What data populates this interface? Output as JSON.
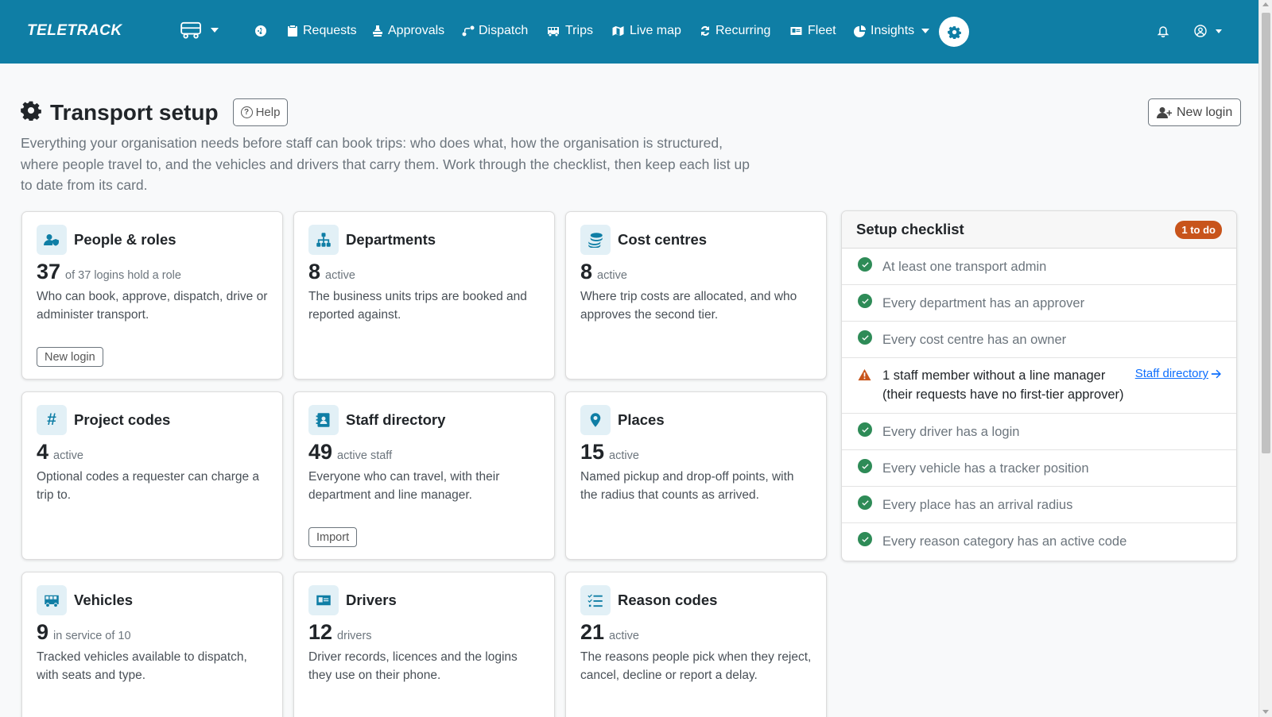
{
  "nav": {
    "brand": "TELETRACK",
    "items": [
      {
        "label": "Requests",
        "icon": "clipboard-icon"
      },
      {
        "label": "Approvals",
        "icon": "stamp-icon"
      },
      {
        "label": "Dispatch",
        "icon": "route-icon"
      },
      {
        "label": "Trips",
        "icon": "bus-icon"
      },
      {
        "label": "Live map",
        "icon": "map-icon"
      },
      {
        "label": "Recurring",
        "icon": "repeat-icon"
      },
      {
        "label": "Fleet",
        "icon": "id-card-icon"
      },
      {
        "label": "Insights",
        "icon": "pie-chart-icon"
      }
    ]
  },
  "header": {
    "title": "Transport setup",
    "help_label": "Help",
    "new_login_label": "New login",
    "intro": "Everything your organisation needs before staff can book trips: who does what, how the organisation is structured, where people travel to, and the vehicles and drivers that carry them. Work through the checklist, then keep each list up to date from its card."
  },
  "cards": [
    {
      "title": "People & roles",
      "icon": "user-shield-icon",
      "count": "37",
      "count_sub": "of 37 logins hold a role",
      "desc": "Who can book, approve, dispatch, drive or administer transport.",
      "button": "New login"
    },
    {
      "title": "Departments",
      "icon": "sitemap-icon",
      "count": "8",
      "count_sub": "active",
      "desc": "The business units trips are booked and reported against.",
      "button": ""
    },
    {
      "title": "Cost centres",
      "icon": "coins-icon",
      "count": "8",
      "count_sub": "active",
      "desc": "Where trip costs are allocated, and who approves the second tier.",
      "button": ""
    },
    {
      "title": "Project codes",
      "icon": "hash-icon",
      "count": "4",
      "count_sub": "active",
      "desc": "Optional codes a requester can charge a trip to.",
      "button": ""
    },
    {
      "title": "Staff directory",
      "icon": "address-book-icon",
      "count": "49",
      "count_sub": "active staff",
      "desc": "Everyone who can travel, with their department and line manager.",
      "button": "Import"
    },
    {
      "title": "Places",
      "icon": "map-pin-icon",
      "count": "15",
      "count_sub": "active",
      "desc": "Named pickup and drop-off points, with the radius that counts as arrived.",
      "button": ""
    },
    {
      "title": "Vehicles",
      "icon": "bus-icon",
      "count": "9",
      "count_sub": "in service of 10",
      "desc": "Tracked vehicles available to dispatch, with seats and type.",
      "button": ""
    },
    {
      "title": "Drivers",
      "icon": "id-card-icon",
      "count": "12",
      "count_sub": "drivers",
      "desc": "Driver records, licences and the logins they use on their phone.",
      "button": ""
    },
    {
      "title": "Reason codes",
      "icon": "list-check-icon",
      "count": "21",
      "count_sub": "active",
      "desc": "The reasons people pick when they reject, cancel, decline or report a delay.",
      "button": ""
    }
  ],
  "checklist": {
    "title": "Setup checklist",
    "badge": "1 to do",
    "items": [
      {
        "text": "At least one transport admin",
        "status": "ok"
      },
      {
        "text": "Every department has an approver",
        "status": "ok"
      },
      {
        "text": "Every cost centre has an owner",
        "status": "ok"
      },
      {
        "text": "1 staff member without a line manager (their requests have no first-tier approver)",
        "status": "warn",
        "link": "Staff directory"
      },
      {
        "text": "Every driver has a login",
        "status": "ok"
      },
      {
        "text": "Every vehicle has a tracker position",
        "status": "ok"
      },
      {
        "text": "Every place has an arrival radius",
        "status": "ok"
      },
      {
        "text": "Every reason category has an active code",
        "status": "ok"
      }
    ]
  },
  "colors": {
    "accent": "#0f7ea5",
    "success": "#2e8b57",
    "warning": "#c8541b",
    "link": "#0d6efd"
  }
}
